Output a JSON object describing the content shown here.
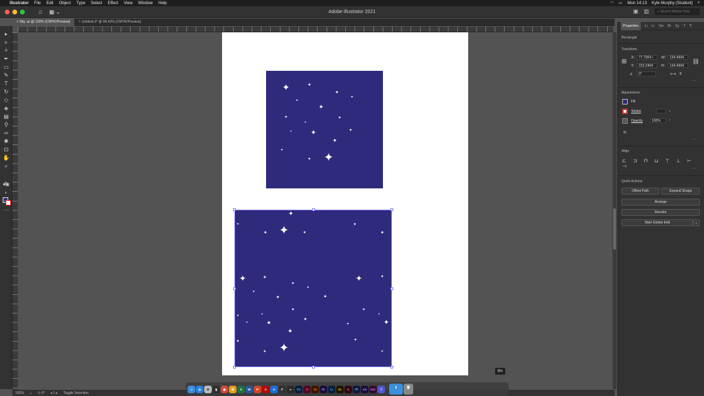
{
  "menubar": {
    "app_name": "Illustrator",
    "items": [
      "File",
      "Edit",
      "Object",
      "Type",
      "Select",
      "Effect",
      "View",
      "Window",
      "Help"
    ],
    "clock": "Mon 14:13",
    "user": "Kyle Murphy (Student)"
  },
  "appbar": {
    "title": "Adobe Illustrator 2021",
    "search_placeholder": "Search Adobe Help"
  },
  "tabs": [
    {
      "label": "Sky .ai @ 100% (CMYK/Preview)",
      "active": true
    },
    {
      "label": "Untitled-2* @ 98.43% (CMYK/Preview)",
      "active": false
    }
  ],
  "panel": {
    "tabs": [
      "Properties"
    ],
    "object_type": "Rectangle",
    "transform": {
      "heading": "Transform",
      "x_label": "X:",
      "x_value": "77.7004 r",
      "y_label": "Y:",
      "y_value": "223.2404",
      "w_label": "W:",
      "w_value": "134.4994",
      "h_label": "H:",
      "h_value": "134.4994",
      "angle_value": "0°"
    },
    "appearance": {
      "heading": "Appearance",
      "fill_label": "Fill",
      "stroke_label": "Stroke",
      "opacity_label": "Opacity",
      "opacity_value": "100%",
      "fx_label": "fx."
    },
    "align": {
      "heading": "Align"
    },
    "quick_actions": {
      "heading": "Quick Actions",
      "offset_path": "Offset Path",
      "expand_shape": "Expand Shape",
      "arrange": "Arrange",
      "recolor": "Recolor",
      "start_global_edit": "Start Global Edit"
    }
  },
  "status": {
    "zoom": "100%",
    "artboard": "1",
    "mode": "Toggle Selection"
  },
  "dock": {
    "tooltip": "Bin",
    "apps": [
      {
        "label": "Ps",
        "color": "#0a1f3c"
      },
      {
        "label": "Id",
        "color": "#4a0b23"
      },
      {
        "label": "Ai",
        "color": "#3a1500"
      },
      {
        "label": "Pr",
        "color": "#1a0f3a"
      },
      {
        "label": "Lr",
        "color": "#0b2035"
      },
      {
        "label": "Br",
        "color": "#1c1500"
      },
      {
        "label": "Ic",
        "color": "#2a0a10"
      },
      {
        "label": "Pl",
        "color": "#0f1a3a"
      },
      {
        "label": "Ae",
        "color": "#1a0f3a"
      },
      {
        "label": "Dw",
        "color": "#2a0f2a"
      }
    ]
  },
  "colors": {
    "navy_fill": "#2e2a7c",
    "selection": "#7b7bff"
  }
}
